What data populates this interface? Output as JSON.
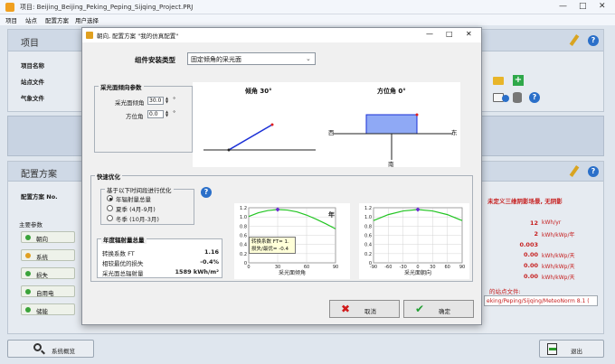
{
  "window": {
    "title": "项目: Beijing_Beijing_Peking_Peping_Sijqing_Project.PRJ"
  },
  "menu": [
    "项目",
    "站点",
    "配置方案",
    "用户选择"
  ],
  "project": {
    "section_title": "项目",
    "fields": [
      "项目名称",
      "站点文件",
      "气象文件"
    ]
  },
  "config": {
    "section_title": "配置方案",
    "scheme_label": "配置方案 No.",
    "main_params_label": "主要参数",
    "items": [
      "朝向",
      "系统",
      "损失",
      "自用电",
      "储能"
    ],
    "warning": "未定义三维阴影场景, 无阴影",
    "values": [
      {
        "num": "12",
        "unit": "kWh/yr"
      },
      {
        "num": "2",
        "unit": "kWh/kWp/年"
      },
      {
        "num": "0.003",
        "unit": ""
      },
      {
        "num": "0.00",
        "unit": "kWh/kWp/天"
      },
      {
        "num": "0.00",
        "unit": "kWh/kWp/天"
      },
      {
        "num": "0.00",
        "unit": "kWh/kWp/天"
      }
    ],
    "site_file_label": "的站点文件:",
    "site_file_value": "eking/Peping/Sijqing/MeteoNorm 8.1 ("
  },
  "bottom": {
    "overview_button": "系统概览",
    "exit_button": "退出"
  },
  "dialog": {
    "title": "朝向, 配置方案 \"我的仿真配置\"",
    "mount_type_label": "组件安装类型",
    "mount_type_value": "固定倾角的采光面",
    "params_group_title": "采光面倾向参数",
    "tilt_label": "采光面倾角",
    "tilt_value": "30.0",
    "azimuth_label": "方位角",
    "azimuth_value": "0.0",
    "deg": "°",
    "tilt_diagram_title": "倾角 30°",
    "azimuth_diagram_title": "方位角 0°",
    "west": "西",
    "east": "东",
    "south": "南",
    "quick_opt_title": "快速优化",
    "opt_subgroup_title": "基于以下时间段进行优化",
    "radio_options": [
      "年辐射量总量",
      "夏季 (4月-9月)",
      "冬季 (10月-3月)"
    ],
    "radio_selected": 0,
    "annual_group_title": "年度辐射量总量",
    "transposition_label": "转换系数 FT",
    "transposition_value": "1.16",
    "loss_label": "相较最优的损失",
    "loss_value": "-0.4%",
    "irradiation_label": "采光面总辐射量",
    "irradiation_value": "1589 kWh/m²",
    "cancel_button": "取消",
    "ok_button": "确定"
  },
  "chart_data": [
    {
      "type": "line",
      "xlabel": "采光面倾角",
      "ylim": [
        0,
        1.2
      ],
      "yticks": [
        "0",
        "0.2",
        "0.4",
        "0.6",
        "0.8",
        "1.0",
        "1.2"
      ],
      "xticks": [
        "0",
        "30",
        "60",
        "90"
      ],
      "corner_label": "年",
      "x": [
        0,
        10,
        20,
        30,
        40,
        50,
        60,
        70,
        80,
        90
      ],
      "series": [
        {
          "values": [
            1.01,
            1.09,
            1.14,
            1.16,
            1.15,
            1.11,
            1.04,
            0.95,
            0.85,
            0.74
          ]
        }
      ],
      "marker": {
        "x": 30,
        "y": 1.16
      },
      "tooltip": [
        "转换系数 FT= 1.",
        "损失/最优= -0.4"
      ],
      "colors": {
        "curve": "#22c522",
        "marker": "#6a2fd0"
      }
    },
    {
      "type": "line",
      "xlabel": "采光面朝向",
      "ylim": [
        0,
        1.2
      ],
      "yticks": [
        "0",
        "0.2",
        "0.4",
        "0.6",
        "0.8",
        "1.0",
        "1.2"
      ],
      "xticks": [
        "-90",
        "-60",
        "-30",
        "0",
        "30",
        "60",
        "90"
      ],
      "x": [
        -90,
        -60,
        -30,
        0,
        30,
        60,
        90
      ],
      "series": [
        {
          "values": [
            0.92,
            1.05,
            1.13,
            1.16,
            1.13,
            1.05,
            0.92
          ]
        }
      ],
      "marker": {
        "x": 0,
        "y": 1.16
      },
      "colors": {
        "curve": "#22c522",
        "marker": "#6a2fd0"
      }
    }
  ]
}
